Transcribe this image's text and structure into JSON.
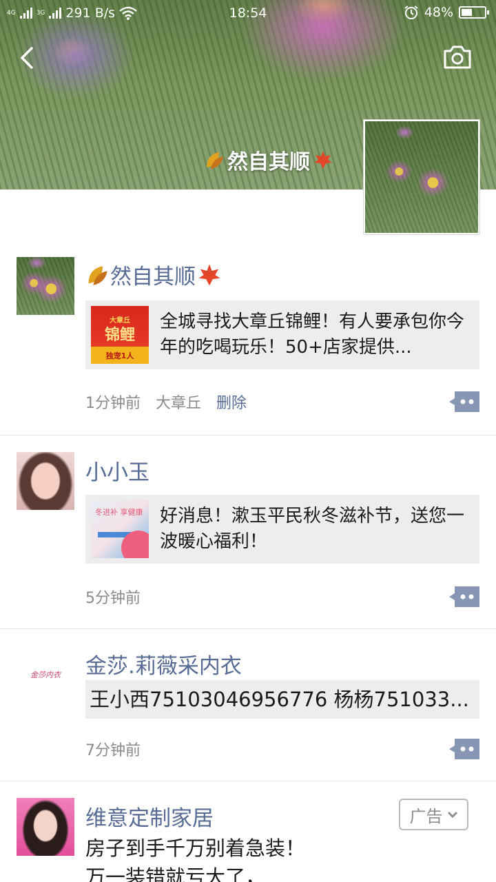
{
  "status_bar": {
    "network_1": "4G",
    "network_2": "3G",
    "speed": "291 B/s",
    "time": "18:54",
    "battery": "48%",
    "battery_level": 0.48
  },
  "cover": {
    "nickname": "然自其顺",
    "leaf_left_icon": "maple-leaf-yellow",
    "leaf_right_icon": "maple-leaf-red"
  },
  "posts": [
    {
      "name": "然自其顺",
      "link_title": "全城寻找大章丘锦鲤！有人要承包你今年的吃喝玩乐！50+店家提供...",
      "thumb_top": "大章丘",
      "thumb_main": "锦鲤",
      "thumb_bottom": "独宠1人",
      "time": "1分钟前",
      "location": "大章丘",
      "delete_label": "删除"
    },
    {
      "name": "小小玉",
      "link_title": "好消息！漱玉平民秋冬滋补节，送您一波暖心福利！",
      "thumb_text": "冬进补 享健康",
      "time": "5分钟前"
    },
    {
      "name": "金莎.莉薇采内衣",
      "text": "王小西75103046956776  杨杨751033...",
      "avatar_text": "金莎内衣",
      "time": "7分钟前"
    },
    {
      "name": "维意定制家居",
      "ad_label": "广告",
      "body_line1": "房子到手千万别着急装！",
      "body_line2": "万一装错就亏大了，"
    }
  ],
  "colors": {
    "link_blue": "#576b95",
    "meta_gray": "#8a8a8a",
    "card_bg": "#ededed"
  }
}
